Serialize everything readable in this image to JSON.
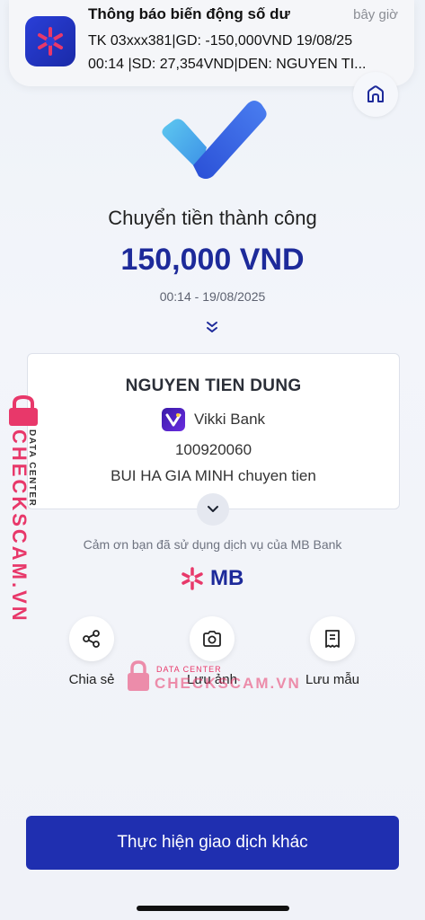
{
  "notification": {
    "title": "Thông báo biến động số dư",
    "time": "bây giờ",
    "line1": "TK 03xxx381|GD: -150,000VND 19/08/25",
    "line2": "00:14 |SD: 27,354VND|DEN: NGUYEN TI..."
  },
  "result": {
    "title": "Chuyển tiền thành công",
    "amount": "150,000 VND",
    "datetime": "00:14 - 19/08/2025"
  },
  "recipient": {
    "name": "NGUYEN TIEN DUNG",
    "bank": "Vikki Bank",
    "account": "100920060",
    "memo": "BUI HA GIA MINH chuyen tien"
  },
  "thanks": "Cảm ơn bạn đã sử dụng dịch vụ của MB Bank",
  "brand": {
    "text": "MB",
    "color": "#1d2a9a",
    "accent": "#e8386a"
  },
  "actions": [
    {
      "label": "Chia sẻ",
      "icon": "share-icon"
    },
    {
      "label": "Lưu ảnh",
      "icon": "camera-icon"
    },
    {
      "label": "Lưu mẫu",
      "icon": "receipt-icon"
    }
  ],
  "primary_button": "Thực hiện giao dịch khác",
  "watermark": {
    "top": "DATA CENTER",
    "main": "CHECKSCAM.VN"
  }
}
